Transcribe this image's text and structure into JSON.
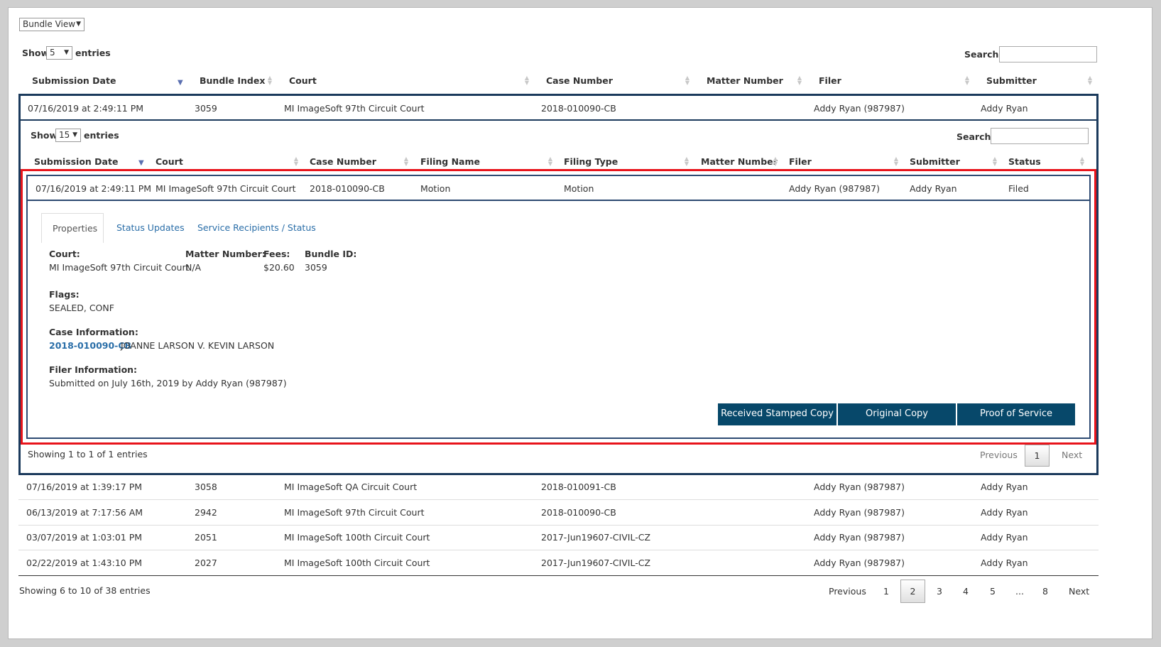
{
  "toolbar": {
    "view_select": "Bundle View"
  },
  "outer": {
    "show_label": "Show",
    "show_value": "5",
    "entries_label": "entries",
    "search_label": "Search:",
    "columns": [
      "Submission Date",
      "Bundle Index",
      "Court",
      "Case Number",
      "Matter Number",
      "Filer",
      "Submitter"
    ],
    "expanded_row": {
      "date": "07/16/2019 at 2:49:11 PM",
      "index": "3059",
      "court": "MI ImageSoft 97th Circuit Court",
      "case": "2018-010090-CB",
      "matter": "",
      "filer": "Addy Ryan (987987)",
      "submitter": "Addy Ryan"
    },
    "rows": [
      {
        "date": "07/16/2019 at 1:39:17 PM",
        "index": "3058",
        "court": "MI ImageSoft QA Circuit Court",
        "case": "2018-010091-CB",
        "matter": "",
        "filer": "Addy Ryan (987987)",
        "submitter": "Addy Ryan"
      },
      {
        "date": "06/13/2019 at 7:17:56 AM",
        "index": "2942",
        "court": "MI ImageSoft 97th Circuit Court",
        "case": "2018-010090-CB",
        "matter": "",
        "filer": "Addy Ryan (987987)",
        "submitter": "Addy Ryan"
      },
      {
        "date": "03/07/2019 at 1:03:01 PM",
        "index": "2051",
        "court": "MI ImageSoft 100th Circuit Court",
        "case": "2017-Jun19607-CIVIL-CZ",
        "matter": "",
        "filer": "Addy Ryan (987987)",
        "submitter": "Addy Ryan"
      },
      {
        "date": "02/22/2019 at 1:43:10 PM",
        "index": "2027",
        "court": "MI ImageSoft 100th Circuit Court",
        "case": "2017-Jun19607-CIVIL-CZ",
        "matter": "",
        "filer": "Addy Ryan (987987)",
        "submitter": "Addy Ryan"
      }
    ],
    "info": "Showing 6 to 10 of 38 entries",
    "pagination": {
      "previous": "Previous",
      "pages": [
        "1",
        "2",
        "3",
        "4",
        "5",
        "...",
        "8"
      ],
      "current": "2",
      "next": "Next"
    }
  },
  "inner": {
    "show_label": "Show",
    "show_value": "15",
    "entries_label": "entries",
    "search_label": "Search:",
    "columns": [
      "Submission Date",
      "Court",
      "Case Number",
      "Filing Name",
      "Filing Type",
      "Matter Number",
      "Filer",
      "Submitter",
      "Status"
    ],
    "row": {
      "date": "07/16/2019 at 2:49:11 PM",
      "court": "MI ImageSoft 97th Circuit Court",
      "case": "2018-010090-CB",
      "filing_name": "Motion",
      "filing_type": "Motion",
      "matter": "",
      "filer": "Addy Ryan (987987)",
      "submitter": "Addy Ryan",
      "status": "Filed"
    },
    "info": "Showing 1 to 1 of 1 entries",
    "pagination": {
      "previous": "Previous",
      "current": "1",
      "next": "Next"
    }
  },
  "details": {
    "tabs": [
      "Properties",
      "Status Updates",
      "Service Recipients / Status"
    ],
    "court_label": "Court:",
    "court_value": "MI ImageSoft 97th Circuit Court",
    "matter_label": "Matter Number:",
    "matter_value": "N/A",
    "fees_label": "Fees:",
    "fees_value": "$20.60",
    "bundle_label": "Bundle ID:",
    "bundle_value": "3059",
    "flags_label": "Flags:",
    "flags_value": "SEALED, CONF",
    "case_label": "Case Information:",
    "case_link": "2018-010090-CB",
    "case_title": "JOANNE LARSON V. KEVIN LARSON",
    "filer_label": "Filer Information:",
    "filer_value": "Submitted on July 16th, 2019 by Addy Ryan (987987)",
    "buttons": [
      "Received Stamped Copy",
      "Original Copy",
      "Proof of Service"
    ]
  },
  "colors": {
    "navy_border": "#1b3a5c",
    "highlight_red": "#e8141b",
    "button_blue": "#07486a",
    "link_blue": "#2a6ea8"
  }
}
